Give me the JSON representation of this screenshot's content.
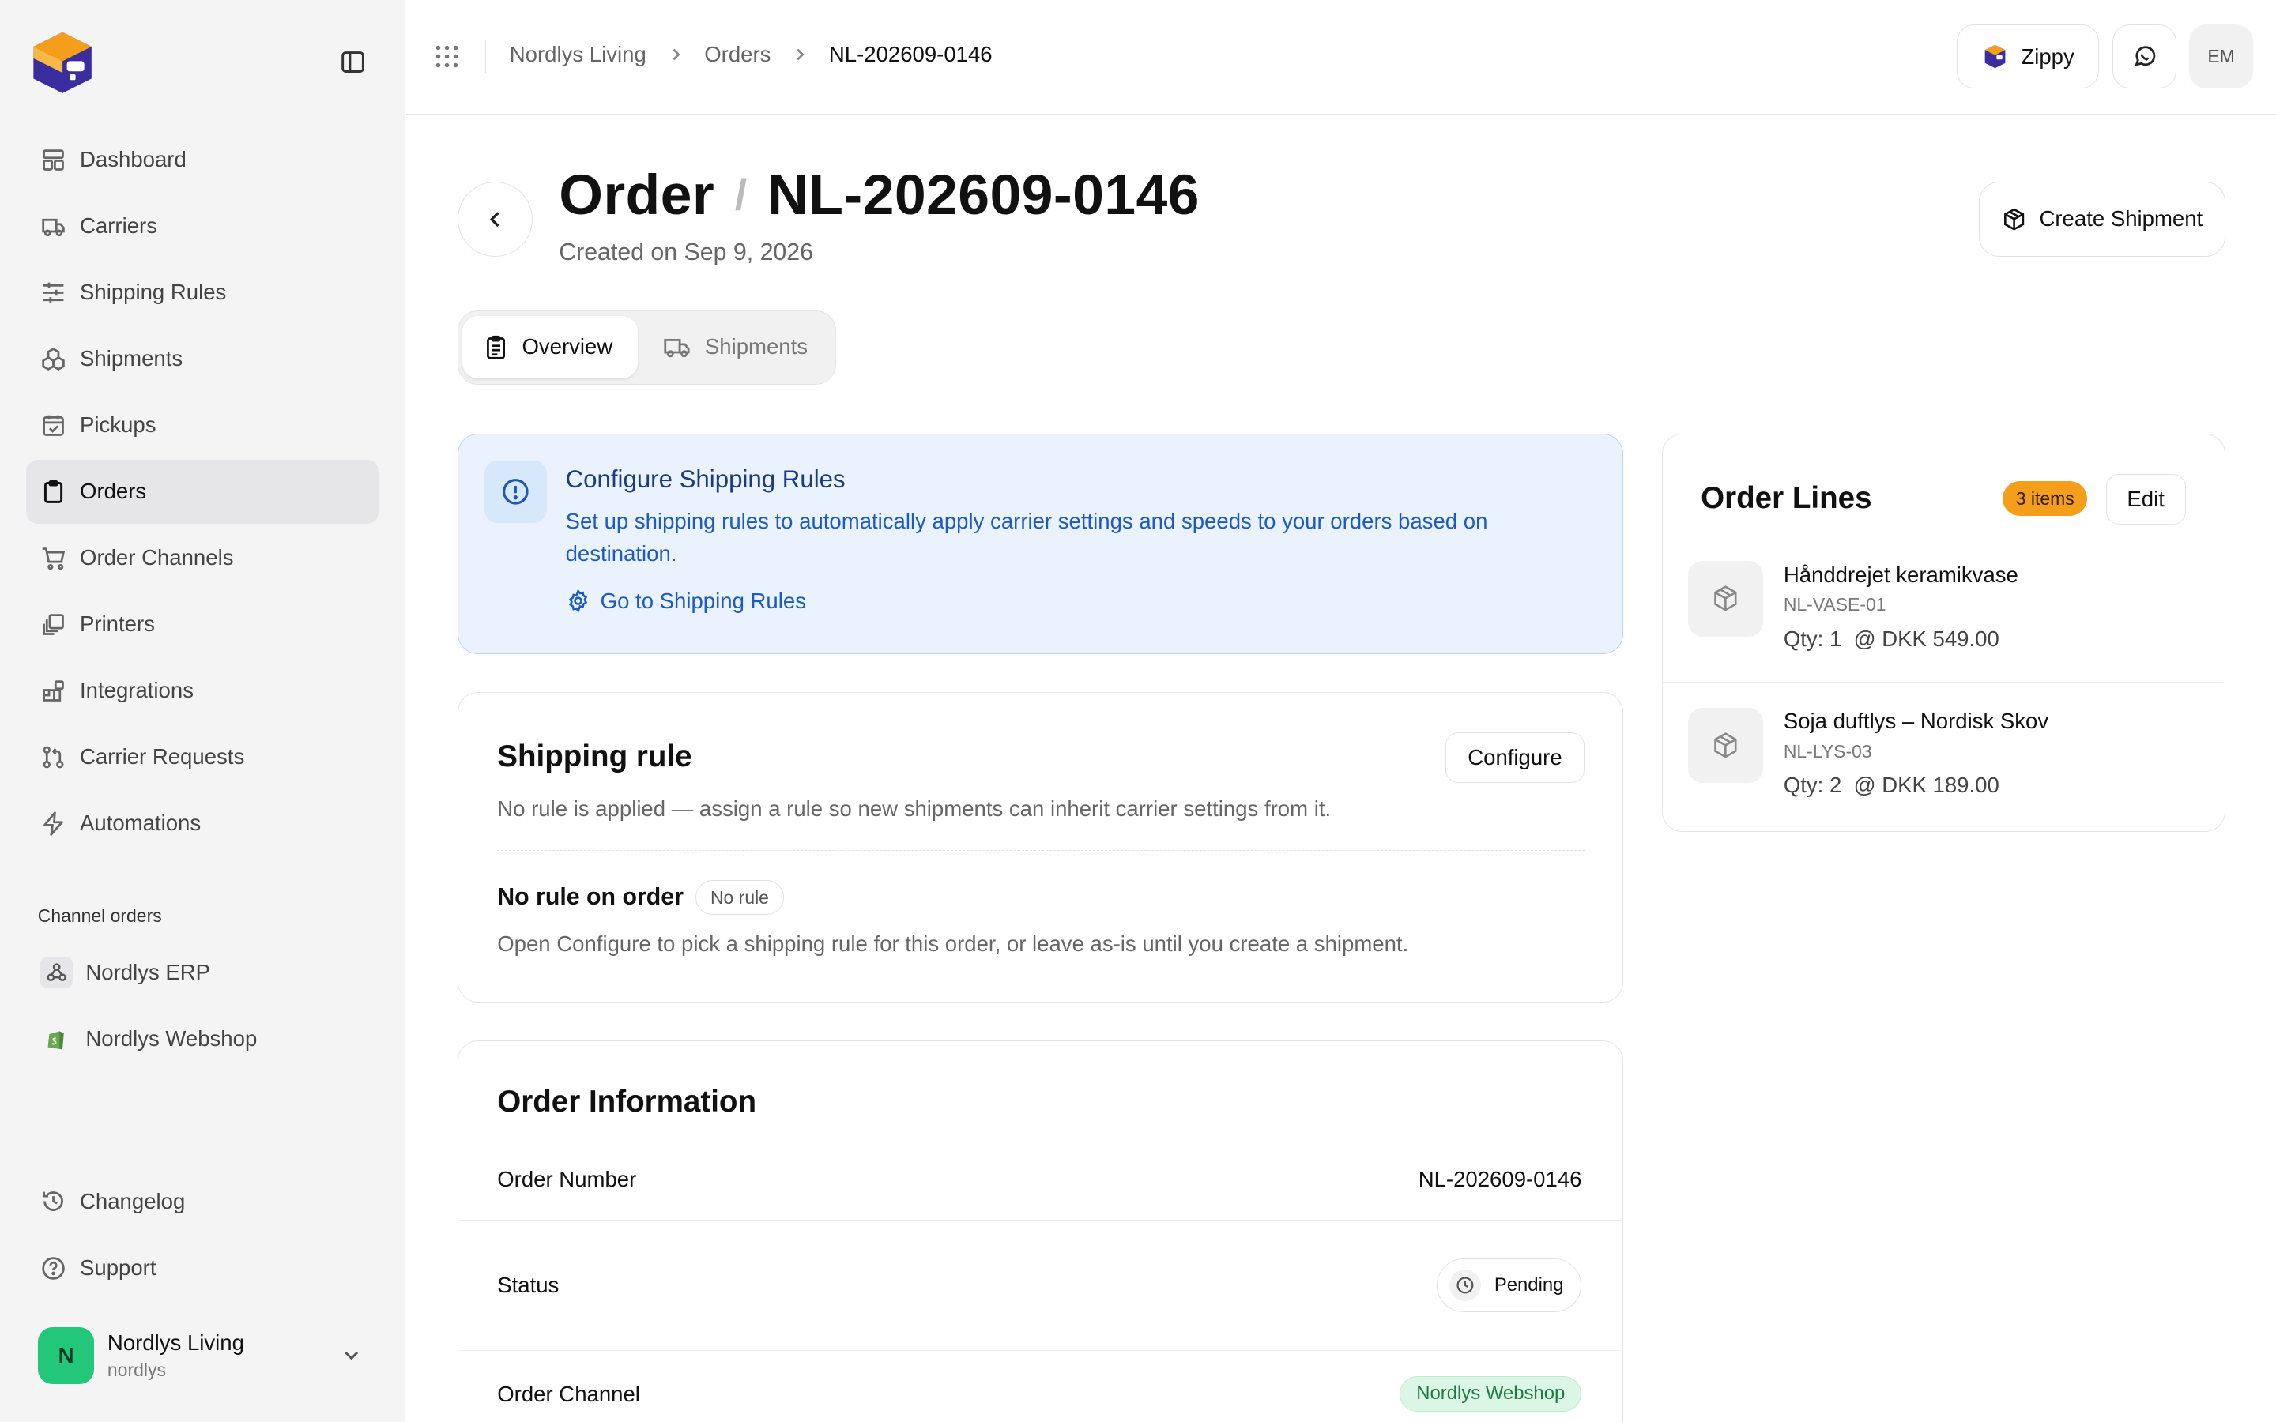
{
  "sidebar": {
    "items": [
      {
        "label": "Dashboard",
        "icon": "dashboard-icon"
      },
      {
        "label": "Carriers",
        "icon": "truck-icon"
      },
      {
        "label": "Shipping Rules",
        "icon": "sliders-icon"
      },
      {
        "label": "Shipments",
        "icon": "boxes-icon"
      },
      {
        "label": "Pickups",
        "icon": "calendar-check-icon"
      },
      {
        "label": "Orders",
        "icon": "clipboard-icon",
        "active": true
      },
      {
        "label": "Order Channels",
        "icon": "cart-icon"
      },
      {
        "label": "Printers",
        "icon": "printer-icon"
      },
      {
        "label": "Integrations",
        "icon": "blocks-icon"
      },
      {
        "label": "Carrier Requests",
        "icon": "git-pull-icon"
      },
      {
        "label": "Automations",
        "icon": "zap-icon"
      }
    ],
    "channel_section_label": "Channel orders",
    "channels": [
      {
        "label": "Nordlys ERP",
        "icon": "webhook-icon"
      },
      {
        "label": "Nordlys Webshop",
        "icon": "shopify-icon"
      }
    ],
    "bottom": [
      {
        "label": "Changelog",
        "icon": "history-icon"
      },
      {
        "label": "Support",
        "icon": "help-circle-icon"
      }
    ],
    "account": {
      "initial": "N",
      "name": "Nordlys Living",
      "handle": "nordlys"
    }
  },
  "topbar": {
    "breadcrumbs": [
      "Nordlys Living",
      "Orders",
      "NL-202609-0146"
    ],
    "zippy_label": "Zippy",
    "user_initials": "EM"
  },
  "header": {
    "title_prefix": "Order",
    "title_separator": "/",
    "order_id": "NL-202609-0146",
    "created": "Created on Sep 9, 2026",
    "create_shipment": "Create Shipment"
  },
  "tabs": [
    {
      "label": "Overview",
      "active": true
    },
    {
      "label": "Shipments",
      "active": false
    }
  ],
  "alert": {
    "title": "Configure Shipping Rules",
    "description": "Set up shipping rules to automatically apply carrier settings and speeds to your orders based on destination.",
    "link": "Go to Shipping Rules"
  },
  "shipping_rule": {
    "title": "Shipping rule",
    "configure": "Configure",
    "description": "No rule is applied — assign a rule so new shipments can inherit carrier settings from it.",
    "state_title": "No rule on order",
    "state_badge": "No rule",
    "state_desc": "Open Configure to pick a shipping rule for this order, or leave as-is until you create a shipment."
  },
  "order_info": {
    "title": "Order Information",
    "rows": {
      "order_number": {
        "label": "Order Number",
        "value": "NL-202609-0146"
      },
      "status": {
        "label": "Status",
        "value": "Pending"
      },
      "channel": {
        "label": "Order Channel",
        "value": "Nordlys Webshop"
      }
    }
  },
  "order_lines": {
    "title": "Order Lines",
    "count_badge": "3 items",
    "edit": "Edit",
    "items": [
      {
        "name": "Hånddrejet keramikvase",
        "sku": "NL-VASE-01",
        "qty": "Qty: 1  @ DKK 549.00"
      },
      {
        "name": "Soja duftlys – Nordisk Skov",
        "sku": "NL-LYS-03",
        "qty": "Qty: 2  @ DKK 189.00"
      }
    ]
  },
  "colors": {
    "accent_blue": "#1d5ac2",
    "alert_bg": "#eaf3fd",
    "badge_orange": "#f59e1b",
    "channel_green": "#1f7a44",
    "avatar_green": "#22c77a"
  }
}
